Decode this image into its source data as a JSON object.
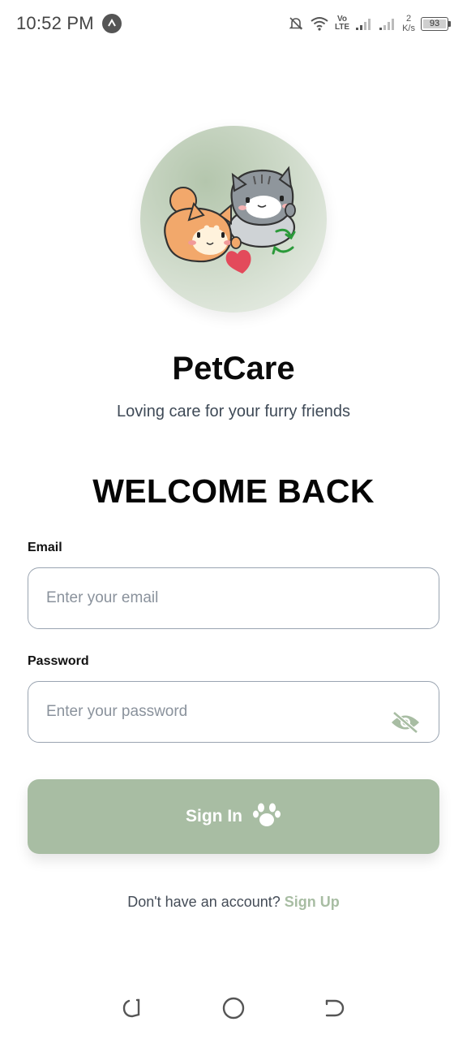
{
  "status_bar": {
    "time": "10:52 PM",
    "app_icon": "caret-up-icon",
    "volte_top": "Vo",
    "volte_bottom": "LTE",
    "net_speed_value": "2",
    "net_speed_unit": "K/s",
    "battery": "93"
  },
  "app": {
    "title": "PetCare",
    "tagline": "Loving care for your furry friends",
    "logo": "pet-mascots-logo"
  },
  "login": {
    "heading": "WELCOME BACK",
    "email_label": "Email",
    "email_placeholder": "Enter your email",
    "email_value": "",
    "password_label": "Password",
    "password_placeholder": "Enter your password",
    "password_value": "",
    "password_toggle_icon": "eye-off-icon",
    "sign_in_label": "Sign In",
    "sign_in_icon": "paw-icon",
    "no_account_text": "Don't have an account?",
    "sign_up_label": "Sign Up"
  },
  "colors": {
    "accent": "#a8bda3",
    "title": "#0a0a0a",
    "tagline": "#3f4a57",
    "input_border": "#9aa4b1"
  },
  "nav_bar": {
    "back_icon": "recent-apps-icon",
    "home_icon": "home-circle-icon",
    "return_icon": "back-icon"
  }
}
